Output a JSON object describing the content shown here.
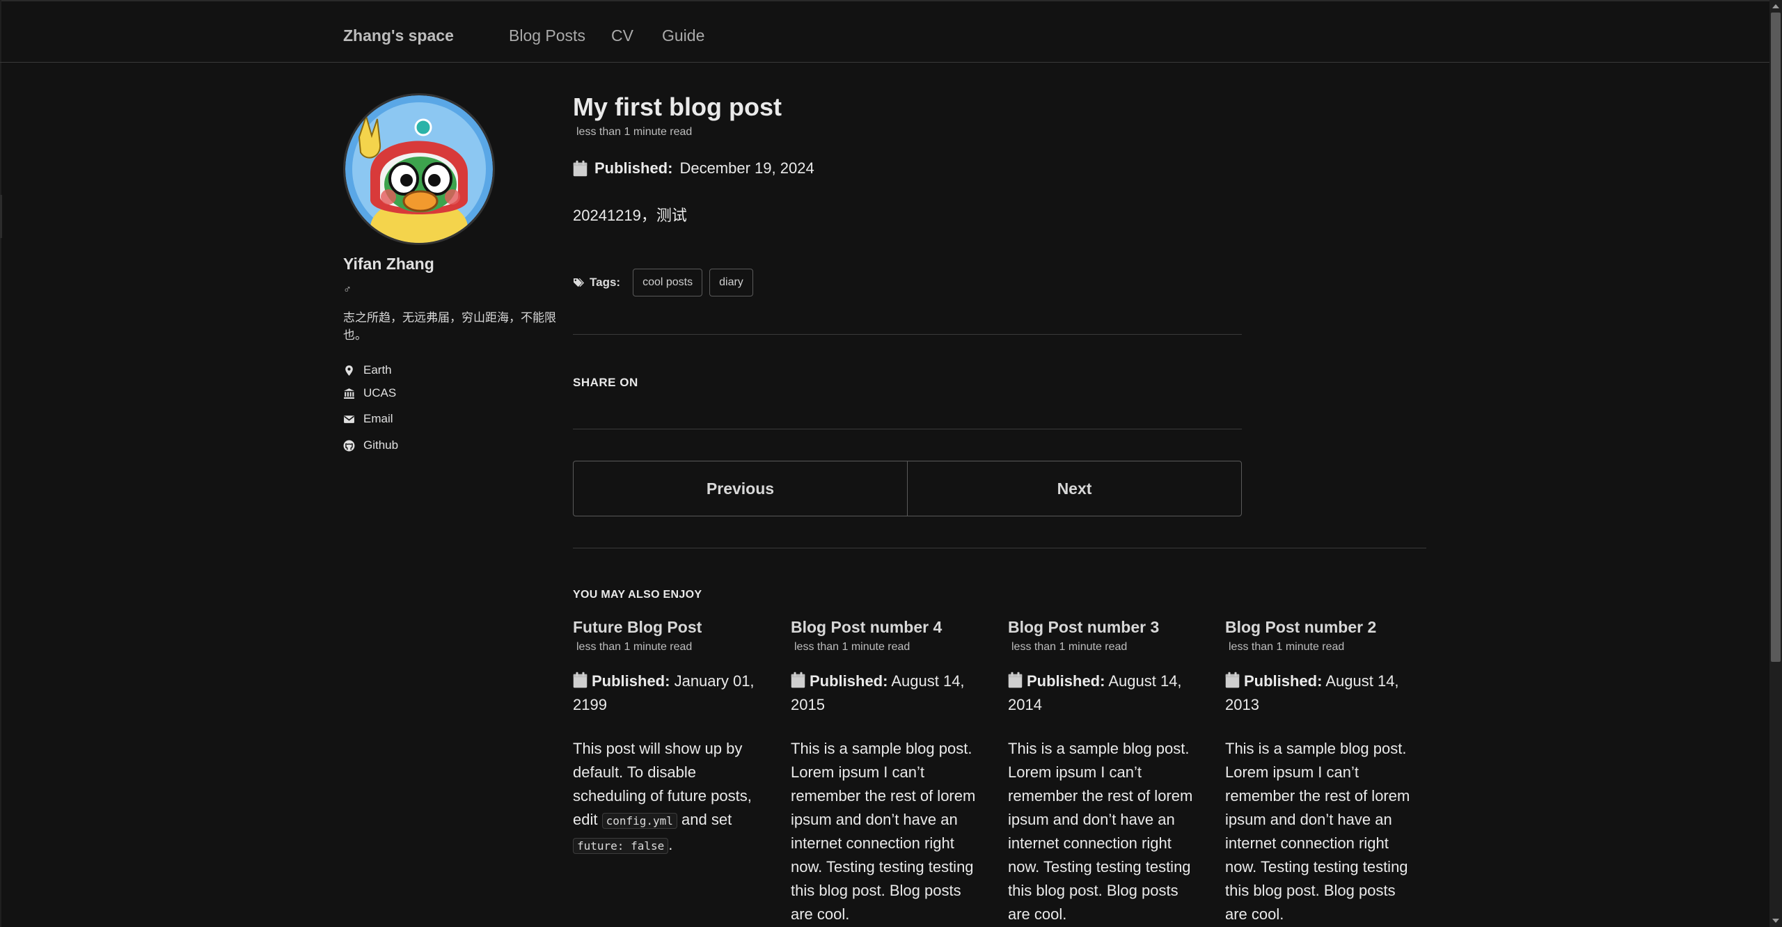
{
  "navbar": {
    "brand": "Zhang's space",
    "links": [
      "Blog Posts",
      "CV",
      "Guide"
    ]
  },
  "author": {
    "name": "Yifan Zhang",
    "gender": "♂",
    "bio": "志之所趋，无远弗届，穷山距海，不能限也。",
    "info": [
      {
        "icon": "map-marker-icon",
        "label": "Earth"
      },
      {
        "icon": "bank-icon",
        "label": "UCAS"
      },
      {
        "icon": "envelope-icon",
        "label": "Email"
      },
      {
        "icon": "github-icon",
        "label": "Github"
      }
    ]
  },
  "post": {
    "title": "My first blog post",
    "read_time": "less than 1 minute read",
    "published_label": "Published:",
    "published_date": "December 19, 2024",
    "content": "20241219，测试",
    "tags_label": "Tags:",
    "tags": [
      "cool posts",
      "diary"
    ]
  },
  "share": {
    "title": "SHARE ON"
  },
  "pager": {
    "previous": "Previous",
    "next": "Next"
  },
  "related": {
    "title": "YOU MAY ALSO ENJOY",
    "posts": [
      {
        "title": "Future Blog Post",
        "read_time": "less than 1 minute read",
        "published_label": "Published:",
        "date": "January 01, 2199",
        "excerpt_a": "This post will show up by default. To disable scheduling of future posts, edit ",
        "code1": "config.yml",
        "excerpt_b": " and set ",
        "code2": "future: false",
        "excerpt_c": "."
      },
      {
        "title": "Blog Post number 4",
        "read_time": "less than 1 minute read",
        "published_label": "Published:",
        "date": "August 14, 2015",
        "excerpt": "This is a sample blog post. Lorem ipsum I can’t remember the rest of lorem ipsum and don’t have an internet connection right now. Testing testing testing this blog post. Blog posts are cool."
      },
      {
        "title": "Blog Post number 3",
        "read_time": "less than 1 minute read",
        "published_label": "Published:",
        "date": "August 14, 2014",
        "excerpt": "This is a sample blog post. Lorem ipsum I can’t remember the rest of lorem ipsum and don’t have an internet connection right now. Testing testing testing this blog post. Blog posts are cool."
      },
      {
        "title": "Blog Post number 2",
        "read_time": "less than 1 minute read",
        "published_label": "Published:",
        "date": "August 14, 2013",
        "excerpt": "This is a sample blog post. Lorem ipsum I can’t remember the rest of lorem ipsum and don’t have an internet connection right now. Testing testing testing this blog post. Blog posts are cool."
      }
    ]
  },
  "colors": {
    "background": "#121212",
    "text": "#eaeaea",
    "muted": "#bdbdbd",
    "border": "#5a5a5a"
  }
}
